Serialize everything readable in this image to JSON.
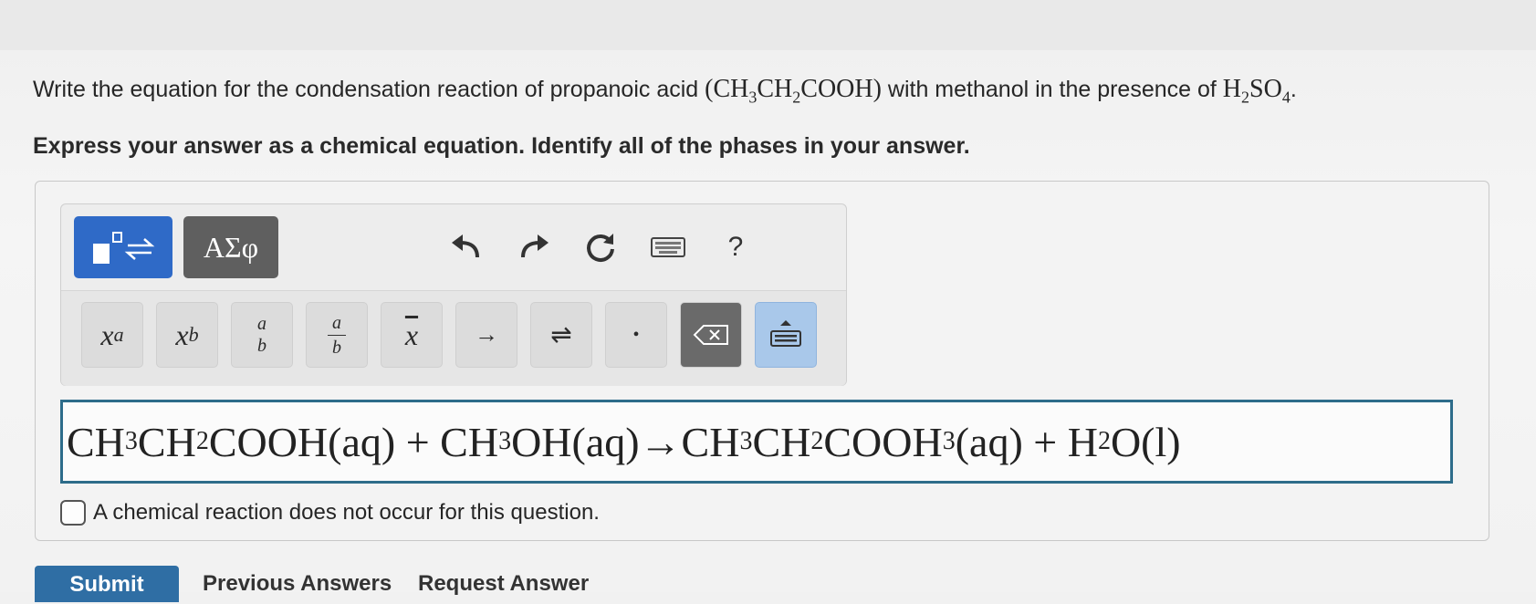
{
  "question": {
    "text": "Write the equation for the condensation reaction of propanoic acid",
    "formula_main": "(CH3CH2COOH)",
    "middle": "with methanol in the presence of",
    "reagent": "H2SO4",
    "end": "."
  },
  "instruction": "Express your answer as a chemical equation. Identify all of the phases in your answer.",
  "toolbar": {
    "greek_label": "ΑΣφ",
    "help_label": "?",
    "keys": {
      "superscript_base": "x",
      "superscript_exp": "a",
      "subscript_base": "x",
      "subscript_sub": "b",
      "stack_top": "a",
      "stack_bottom": "b",
      "frac_top": "a",
      "frac_bottom": "b",
      "overline_base": "x",
      "arrow": "→",
      "equilibrium": "⇌",
      "dot": "•"
    }
  },
  "answer": {
    "t1": "CH",
    "s1": "3",
    "t2": " CH",
    "s2": "2",
    "t3": " COOH(aq) + CH",
    "s3": "3",
    "t4": "OH(aq)→CH",
    "s4": "3",
    "t5": " CH",
    "s5": "2",
    "t6": " COOH",
    "s6": "3",
    "t7": "(aq) + H",
    "s7": "2",
    "t8": " O(l)"
  },
  "no_reaction_label": "A chemical reaction does not occur for this question.",
  "footer": {
    "submit": "Submit",
    "previous": "Previous Answers",
    "request": "Request Answer"
  },
  "colors": {
    "template_button": "#2f6ac7",
    "greek_button": "#5f5f5f",
    "answer_border": "#2d6c8a",
    "submit": "#2f6ea4"
  }
}
